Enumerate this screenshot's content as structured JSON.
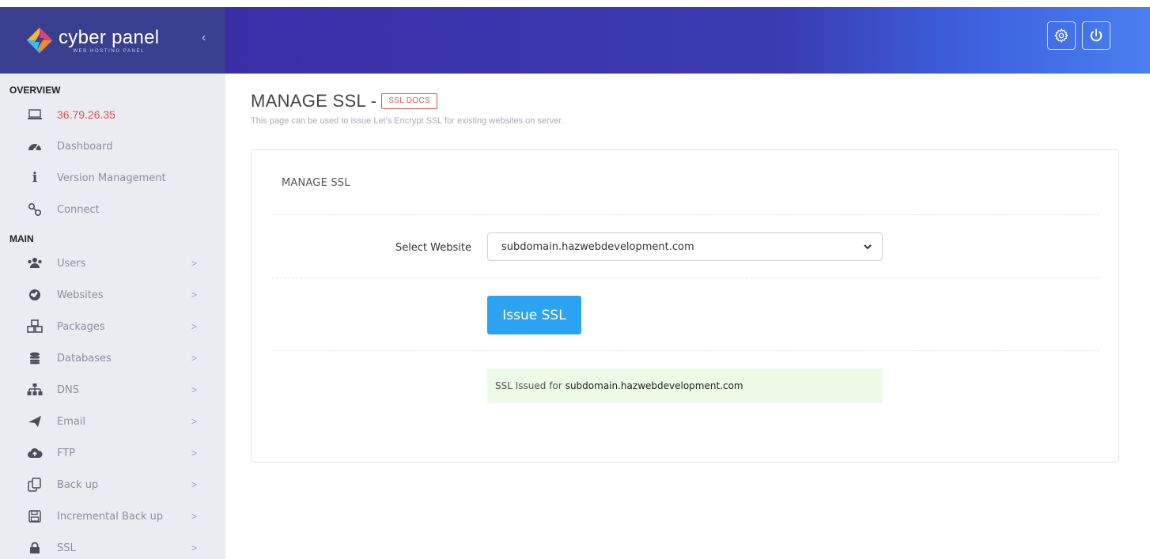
{
  "app": {
    "brand_name": "cyber panel",
    "brand_subtitle": "WEB HOSTING PANEL",
    "collapse_icon": "chevron-left-icon",
    "header_icons": [
      "gear-icon",
      "power-icon"
    ]
  },
  "sidebar": {
    "overview_heading": "OVERVIEW",
    "main_heading": "MAIN",
    "overview_items": [
      {
        "label": "36.79.26.35",
        "icon": "laptop-icon"
      },
      {
        "label": "Dashboard",
        "icon": "dashboard-icon"
      },
      {
        "label": "Version Management",
        "icon": "info-icon"
      },
      {
        "label": "Connect",
        "icon": "link-icon"
      }
    ],
    "main_items": [
      {
        "label": "Users",
        "icon": "users-icon"
      },
      {
        "label": "Websites",
        "icon": "globe-icon"
      },
      {
        "label": "Packages",
        "icon": "cubes-icon"
      },
      {
        "label": "Databases",
        "icon": "database-icon"
      },
      {
        "label": "DNS",
        "icon": "sitemap-icon"
      },
      {
        "label": "Email",
        "icon": "paper-plane-icon"
      },
      {
        "label": "FTP",
        "icon": "cloud-upload-icon"
      },
      {
        "label": "Back up",
        "icon": "copy-icon"
      },
      {
        "label": "Incremental Back up",
        "icon": "save-icon"
      },
      {
        "label": "SSL",
        "icon": "lock-icon"
      }
    ],
    "chevron": ">"
  },
  "page": {
    "title": "MANAGE SSL -",
    "docs_badge": "SSL DOCS",
    "description": "This page can be used to issue Let's Encrypt SSL for existing websites on server."
  },
  "panel": {
    "title": "MANAGE SSL",
    "select_label": "Select Website",
    "selected_website": "subdomain.hazwebdevelopment.com",
    "issue_button": "Issue SSL",
    "alert_prefix": "SSL Issued for",
    "alert_domain": "subdomain.hazwebdevelopment.com"
  },
  "colors": {
    "header_start": "#3b2fa8",
    "header_end": "#4a7ff0",
    "brand_bg": "#3a3f8f",
    "sidebar_bg": "#ebecf2",
    "accent_red": "#e05050",
    "button_blue": "#2ba3f2",
    "alert_green": "#ebfbe6"
  }
}
